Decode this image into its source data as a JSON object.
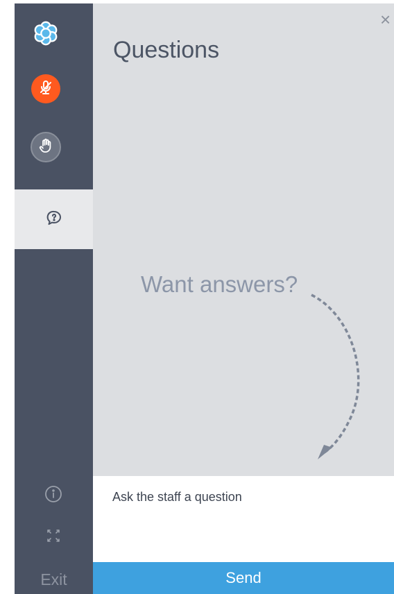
{
  "sidebar": {
    "exit_label": "Exit",
    "icons": {
      "logo": "flower-logo-icon",
      "mic": "mic-muted-icon",
      "hand": "raise-hand-icon",
      "questions": "question-bubble-icon",
      "info": "info-icon",
      "expand": "expand-icon"
    },
    "colors": {
      "background": "#4a5263",
      "mic": "#ff5a1f",
      "active_tab": "#e8e9eb"
    }
  },
  "panel": {
    "title": "Questions",
    "close_label": "×",
    "empty_prompt": "Want answers?"
  },
  "input": {
    "placeholder": "Ask the staff a question",
    "value": ""
  },
  "send_label": "Send",
  "colors": {
    "send": "#3ea1df",
    "panel": "#dcdee1"
  }
}
